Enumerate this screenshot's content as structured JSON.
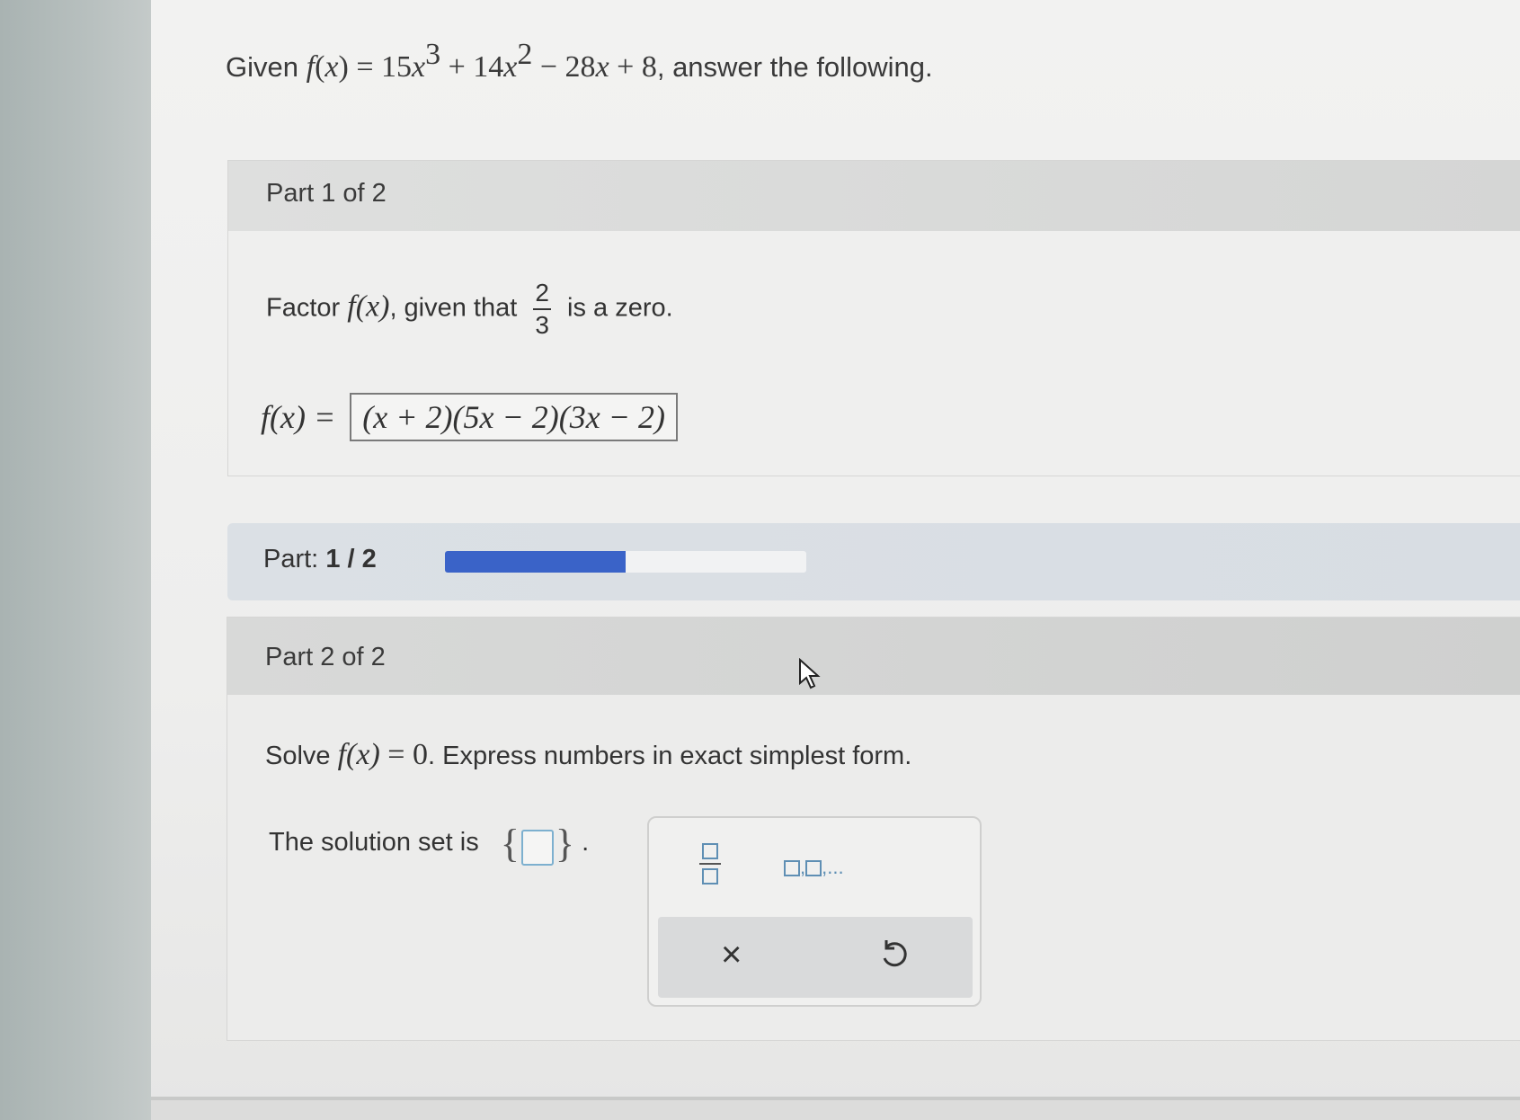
{
  "header": {
    "given": "Given",
    "fx": "f",
    "lp": "(",
    "x": "x",
    "rp": ")",
    "eq": " = 15",
    "x1": "x",
    "e1": "3",
    "t2": " + 14",
    "x2": "x",
    "e2": "2",
    "t3": " − 28",
    "x3": "x",
    "t4": " + 8",
    "tail": ", answer the following."
  },
  "part1": {
    "title": "Part 1 of 2",
    "prompt_pre": "Factor",
    "prompt_fx": "f(x)",
    "prompt_mid": ", given that",
    "frac_num": "2",
    "frac_den": "3",
    "prompt_post": "is a zero.",
    "lhs": "f(x) =",
    "answer": "(x + 2)(5x − 2)(3x − 2)"
  },
  "progress": {
    "label": "Part:",
    "value": "1 / 2",
    "fraction": 0.5,
    "fill_color": "#3a63c8"
  },
  "part2": {
    "title": "Part 2 of 2",
    "prompt_pre": "Solve",
    "prompt_fx": "f(x)",
    "prompt_eq": " = 0",
    "prompt_post": ". Express numbers in exact simplest form.",
    "solution_label": "The solution set is",
    "set_open": "{",
    "set_close": "}",
    "period": "."
  },
  "palette": {
    "fraction_icon": "fraction-template-icon",
    "list_icon": "list-template-icon",
    "list_suffix": ",...",
    "clear_icon": "×",
    "undo_icon": "undo-icon"
  }
}
